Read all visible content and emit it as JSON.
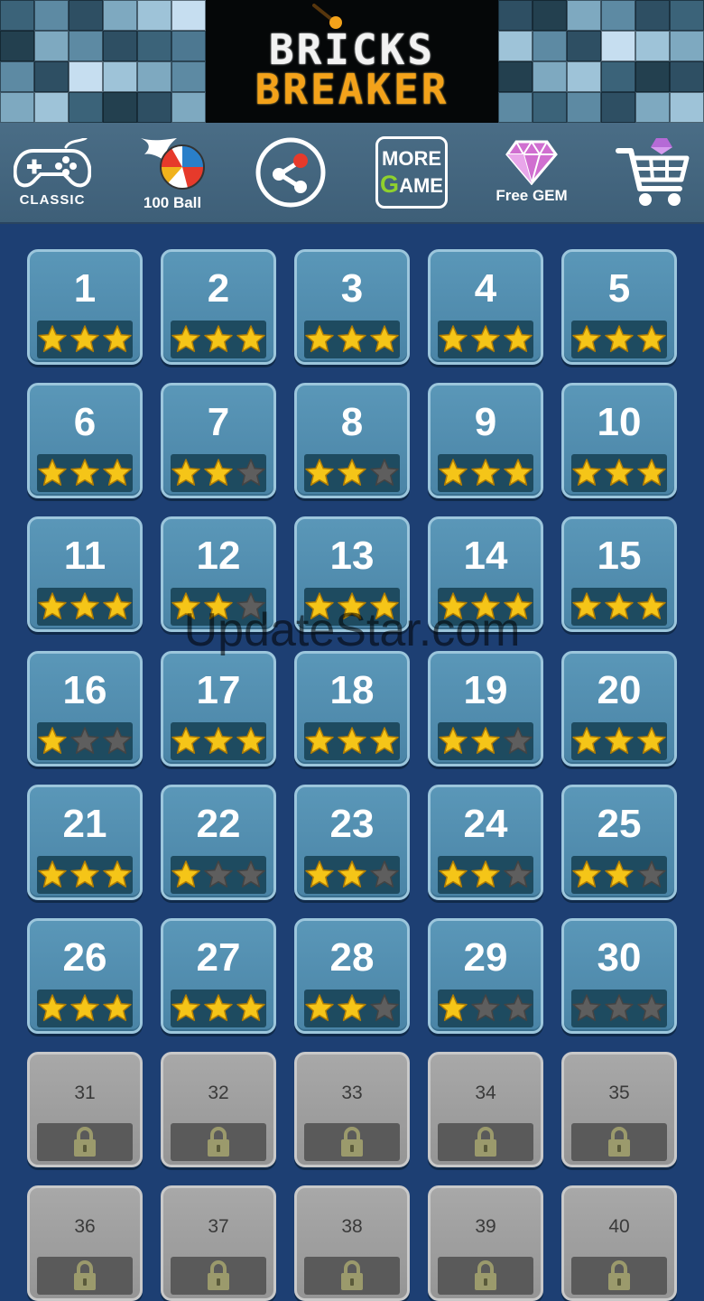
{
  "header": {
    "title_line1": "BRICKS",
    "title_line2": "BREAKER"
  },
  "toolbar": {
    "classic_label": "CLASSIC",
    "hundred_ball_label": "100 Ball",
    "more_game_line1": "MORE",
    "more_game_g": "G",
    "more_game_rest": "AME",
    "free_gem_label": "Free GEM"
  },
  "colors": {
    "star_earned": "#f5c518",
    "star_empty": "#5e5e5e",
    "background": "#1d3f73",
    "tile_unlocked": "#4f8cae",
    "tile_locked": "#9e9e9e"
  },
  "levels": [
    {
      "number": "1",
      "stars": 3,
      "locked": false
    },
    {
      "number": "2",
      "stars": 3,
      "locked": false
    },
    {
      "number": "3",
      "stars": 3,
      "locked": false
    },
    {
      "number": "4",
      "stars": 3,
      "locked": false
    },
    {
      "number": "5",
      "stars": 3,
      "locked": false
    },
    {
      "number": "6",
      "stars": 3,
      "locked": false
    },
    {
      "number": "7",
      "stars": 2,
      "locked": false
    },
    {
      "number": "8",
      "stars": 2,
      "locked": false
    },
    {
      "number": "9",
      "stars": 3,
      "locked": false
    },
    {
      "number": "10",
      "stars": 3,
      "locked": false
    },
    {
      "number": "11",
      "stars": 3,
      "locked": false
    },
    {
      "number": "12",
      "stars": 2,
      "locked": false
    },
    {
      "number": "13",
      "stars": 3,
      "locked": false
    },
    {
      "number": "14",
      "stars": 3,
      "locked": false
    },
    {
      "number": "15",
      "stars": 3,
      "locked": false
    },
    {
      "number": "16",
      "stars": 1,
      "locked": false
    },
    {
      "number": "17",
      "stars": 3,
      "locked": false
    },
    {
      "number": "18",
      "stars": 3,
      "locked": false
    },
    {
      "number": "19",
      "stars": 2,
      "locked": false
    },
    {
      "number": "20",
      "stars": 3,
      "locked": false
    },
    {
      "number": "21",
      "stars": 3,
      "locked": false
    },
    {
      "number": "22",
      "stars": 1,
      "locked": false
    },
    {
      "number": "23",
      "stars": 2,
      "locked": false
    },
    {
      "number": "24",
      "stars": 2,
      "locked": false
    },
    {
      "number": "25",
      "stars": 2,
      "locked": false
    },
    {
      "number": "26",
      "stars": 3,
      "locked": false
    },
    {
      "number": "27",
      "stars": 3,
      "locked": false
    },
    {
      "number": "28",
      "stars": 2,
      "locked": false
    },
    {
      "number": "29",
      "stars": 1,
      "locked": false
    },
    {
      "number": "30",
      "stars": 0,
      "locked": false
    },
    {
      "number": "31",
      "stars": 0,
      "locked": true
    },
    {
      "number": "32",
      "stars": 0,
      "locked": true
    },
    {
      "number": "33",
      "stars": 0,
      "locked": true
    },
    {
      "number": "34",
      "stars": 0,
      "locked": true
    },
    {
      "number": "35",
      "stars": 0,
      "locked": true
    },
    {
      "number": "36",
      "stars": 0,
      "locked": true
    },
    {
      "number": "37",
      "stars": 0,
      "locked": true
    },
    {
      "number": "38",
      "stars": 0,
      "locked": true
    },
    {
      "number": "39",
      "stars": 0,
      "locked": true
    },
    {
      "number": "40",
      "stars": 0,
      "locked": true
    }
  ],
  "watermark": "UpdateStar.com"
}
